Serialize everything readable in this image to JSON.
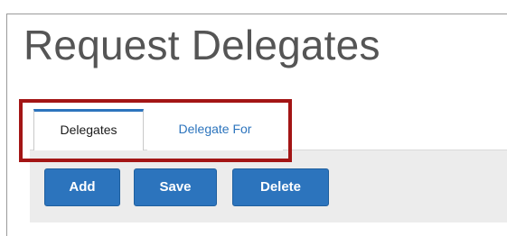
{
  "page": {
    "title": "Request Delegates"
  },
  "tabs": [
    {
      "label": "Delegates",
      "selected": true
    },
    {
      "label": "Delegate For",
      "selected": false
    }
  ],
  "toolbar": {
    "add_label": "Add",
    "save_label": "Save",
    "delete_label": "Delete"
  },
  "colors": {
    "accent": "#2c74bd",
    "highlight": "#a31515",
    "toolbar_bg": "#ececec",
    "title_text": "#555555"
  }
}
